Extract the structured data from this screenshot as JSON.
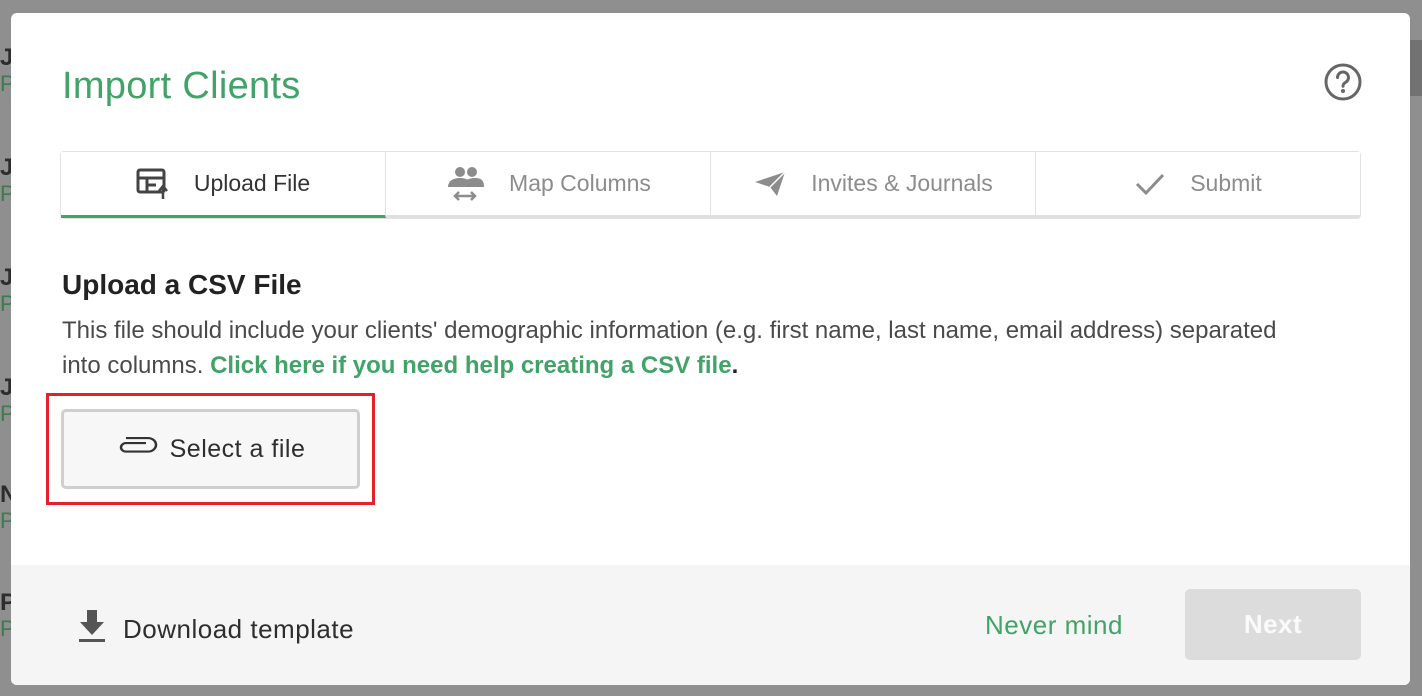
{
  "dialog": {
    "title": "Import Clients",
    "help_icon": "help-circle-icon"
  },
  "steps": [
    {
      "label": "Upload File",
      "icon": "table-upload-icon",
      "active": true
    },
    {
      "label": "Map Columns",
      "icon": "people-swap-icon",
      "active": false
    },
    {
      "label": "Invites & Journals",
      "icon": "paper-plane-icon",
      "active": false
    },
    {
      "label": "Submit",
      "icon": "check-icon",
      "active": false
    }
  ],
  "upload": {
    "heading": "Upload a CSV File",
    "description": "This file should include your clients' demographic information (e.g. first name, last name, email address) separated into columns. ",
    "help_link": "Click here if you need help creating a CSV file",
    "help_link_suffix": ".",
    "select_label": "Select a file",
    "select_icon": "paperclip-icon"
  },
  "footer": {
    "download_label": "Download template",
    "download_icon": "download-icon",
    "cancel_label": "Never mind",
    "next_label": "Next"
  },
  "colors": {
    "accent": "#41a367",
    "highlight": "#e4202a",
    "disabled": "#dcdcdc"
  }
}
